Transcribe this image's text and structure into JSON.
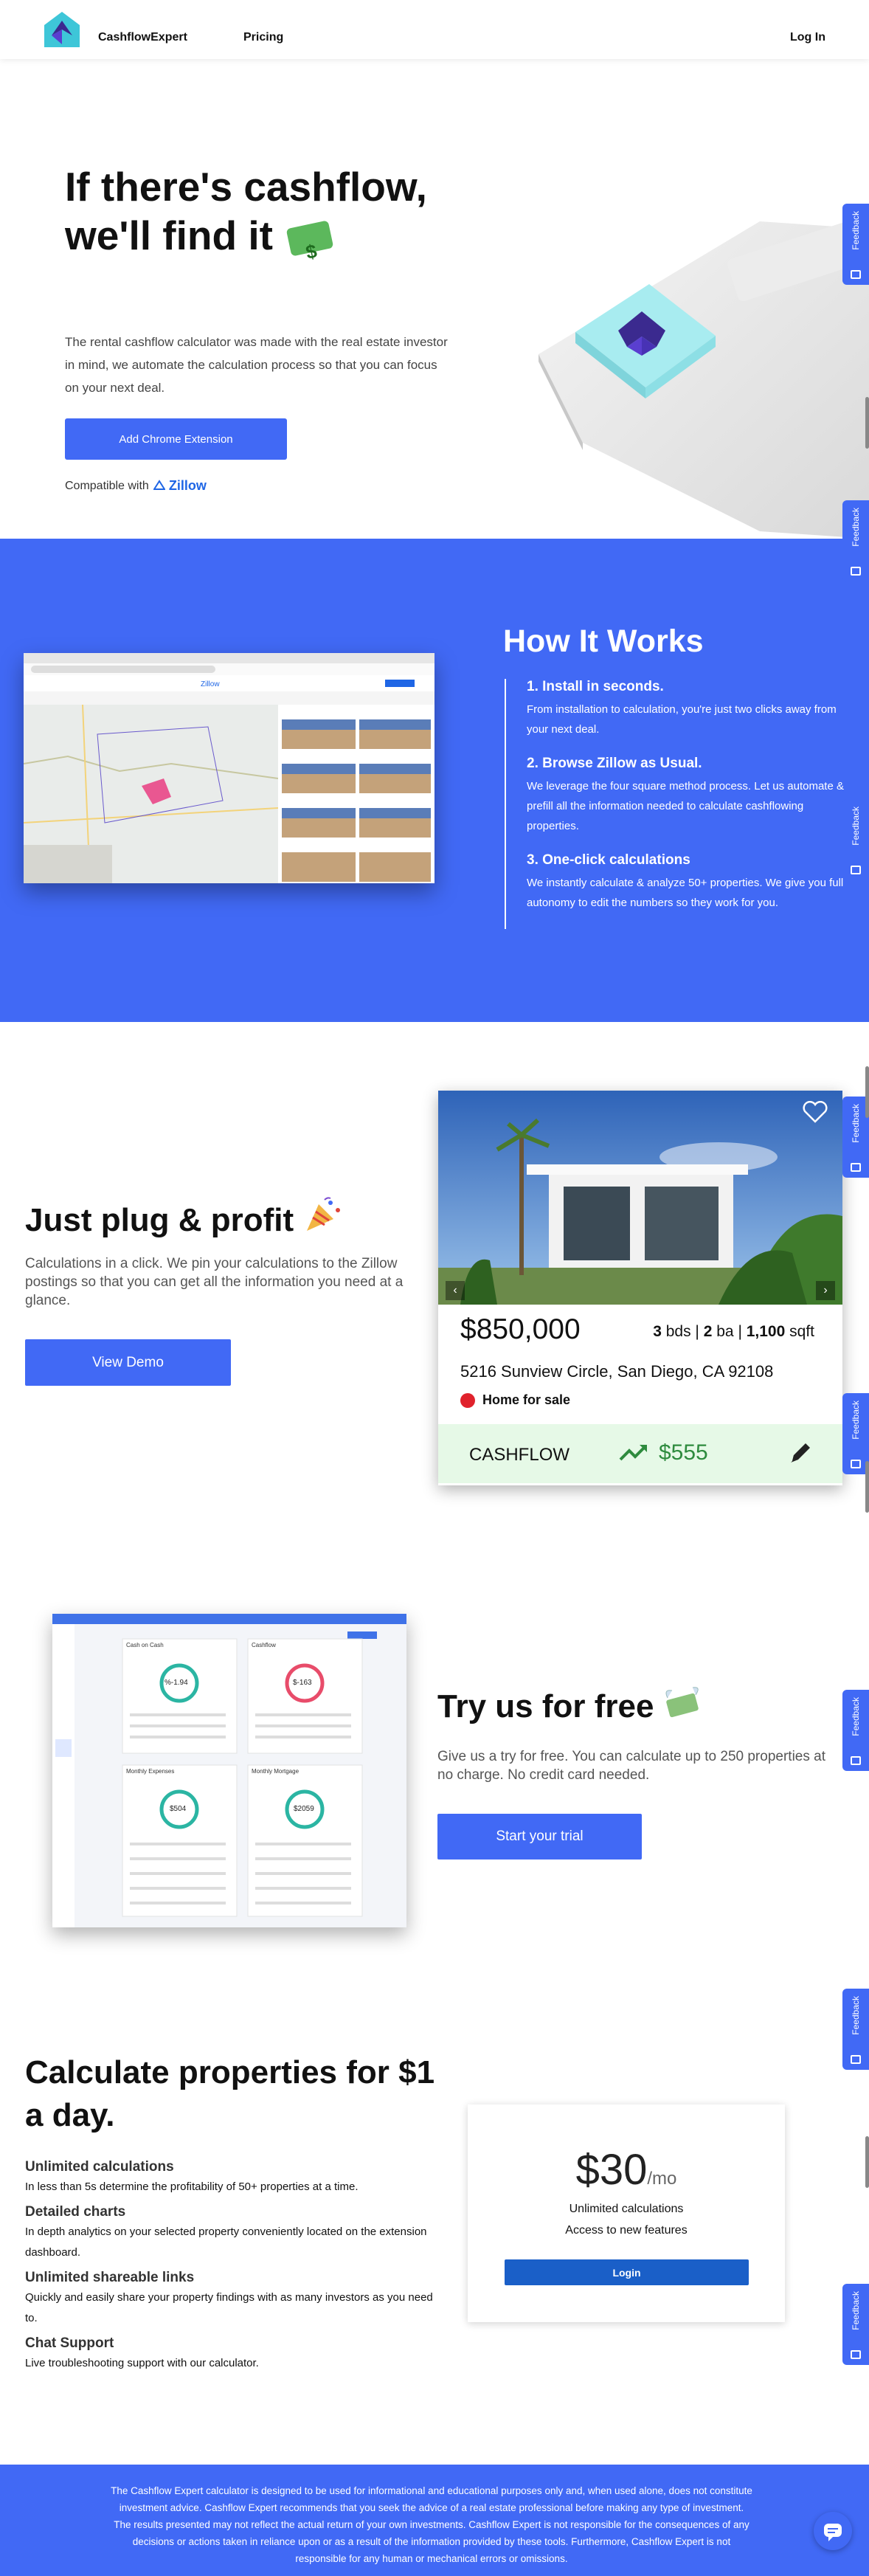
{
  "nav": {
    "brand": "CashflowExpert",
    "pricing": "Pricing",
    "login": "Log In"
  },
  "hero": {
    "title_line1": "If there's cashflow,",
    "title_line2": "we'll find it",
    "description": "The rental cashflow calculator was made with the real estate investor in mind, we automate the calculation process so that you can focus on your next deal.",
    "cta": "Add Chrome Extension",
    "compatible": "Compatible with",
    "zillow": "Zillow"
  },
  "feedback_label": "Feedback",
  "how": {
    "title": "How It Works",
    "steps": [
      {
        "title": "1. Install in seconds.",
        "body": "From installation to calculation, you're just two clicks away from your next deal."
      },
      {
        "title": "2. Browse Zillow as Usual.",
        "body": "We leverage the four square method process. Let us automate & prefill all the information needed to calculate cashflowing properties."
      },
      {
        "title": "3. One-click calculations",
        "body": "We instantly calculate & analyze 50+ properties. We give you full autonomy to edit the numbers so they work for you."
      }
    ]
  },
  "plug": {
    "title": "Just plug & profit",
    "description": "Calculations in a click. We pin your calculations to the Zillow postings so that you can get all the information you need at a glance.",
    "cta": "View Demo",
    "card": {
      "price": "$850,000",
      "beds": "3",
      "beds_unit": "bds",
      "baths": "2",
      "baths_unit": "ba",
      "sqft": "1,100",
      "sqft_unit": "sqft",
      "address": "5216 Sunview Circle, San Diego, CA 92108",
      "status": "Home for sale",
      "cashflow_label": "CASHFLOW",
      "cashflow_value": "$555"
    }
  },
  "try": {
    "title": "Try us for free",
    "description": "Give us a try for free. You can calculate up to 250 properties at no charge. No credit card needed.",
    "cta": "Start your trial",
    "dashboard": {
      "panels": [
        {
          "title": "Cash on Cash",
          "value": "%-1.94"
        },
        {
          "title": "Cashflow",
          "value": "$-163"
        },
        {
          "title": "Monthly Expenses",
          "value": "$504"
        },
        {
          "title": "Monthly Mortgage",
          "value": "$2059"
        }
      ]
    }
  },
  "pricing": {
    "title": "Calculate properties for $1 a day.",
    "features": [
      {
        "title": "Unlimited calculations",
        "body": "In less than 5s determine the profitability of 50+ properties at a time."
      },
      {
        "title": "Detailed charts",
        "body": "In depth analytics on your selected property conveniently located on the extension dashboard."
      },
      {
        "title": "Unlimited shareable links",
        "body": "Quickly and easily share your property findings with as many investors as you need to."
      },
      {
        "title": "Chat Support",
        "body": "Live troubleshooting support with our calculator."
      }
    ],
    "amount": "$30",
    "period": "/mo",
    "line1": "Unlimited calculations",
    "line2": "Access to new features",
    "cta": "Login"
  },
  "footer": {
    "disclaimer": "The Cashflow Expert calculator is designed to be used for informational and educational purposes only and, when used alone, does not constitute investment advice. Cashflow Expert recommends that you seek the advice of a real estate professional before making any type of investment. The results presented may not reflect the actual return of your own investments. Cashflow Expert is not responsible for the consequences of any decisions or actions taken in reliance upon or as a result of the information provided by these tools. Furthermore, Cashflow Expert is not responsible for any human or mechanical errors or omissions."
  },
  "colors": {
    "primary": "#4169f5",
    "cashflow_green": "#2e8b3e",
    "status_red": "#e0222c"
  }
}
